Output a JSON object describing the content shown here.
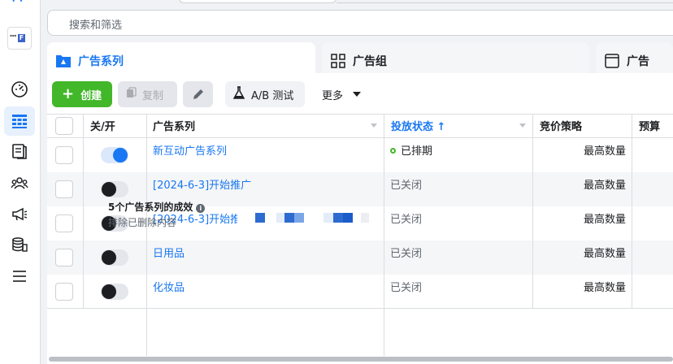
{
  "search": {
    "placeholder": "搜索和筛选"
  },
  "tabs": [
    {
      "label": "广告系列",
      "icon": "folder-icon",
      "active": true
    },
    {
      "label": "广告组",
      "icon": "grid-icon",
      "active": false
    },
    {
      "label": "广告",
      "icon": "ad-square-icon",
      "active": false
    }
  ],
  "toolbar": {
    "create_label": "创建",
    "copy_label": "复制",
    "ab_label": "A/B 测试",
    "more_label": "更多"
  },
  "table": {
    "columns": {
      "toggle": "关/开",
      "name": "广告系列",
      "status": "投放状态 ↑",
      "bid": "竞价策略",
      "budget": "预算"
    },
    "rows": [
      {
        "name": "新互动广告系列",
        "on": true,
        "status": "已排期",
        "status_active": true,
        "bid": "最高数量"
      },
      {
        "name": "[2024-6-3]开始推广",
        "on": false,
        "status": "已关闭",
        "status_active": false,
        "bid": "最高数量"
      },
      {
        "name": "[2024-6-3]开始推广",
        "on": false,
        "status": "已关闭",
        "status_active": false,
        "bid": "最高数量"
      },
      {
        "name": "日用品",
        "on": false,
        "status": "已关闭",
        "status_active": false,
        "bid": "最高数量"
      },
      {
        "name": "化妆品",
        "on": false,
        "status": "已关闭",
        "status_active": false,
        "bid": "最高数量"
      }
    ],
    "footer": {
      "title": "5个广告系列的成效",
      "subtitle": "排除已删除内容"
    }
  },
  "colors": {
    "accent": "#1877f2",
    "create": "#42b72a",
    "scheduled": "#42b72a"
  }
}
